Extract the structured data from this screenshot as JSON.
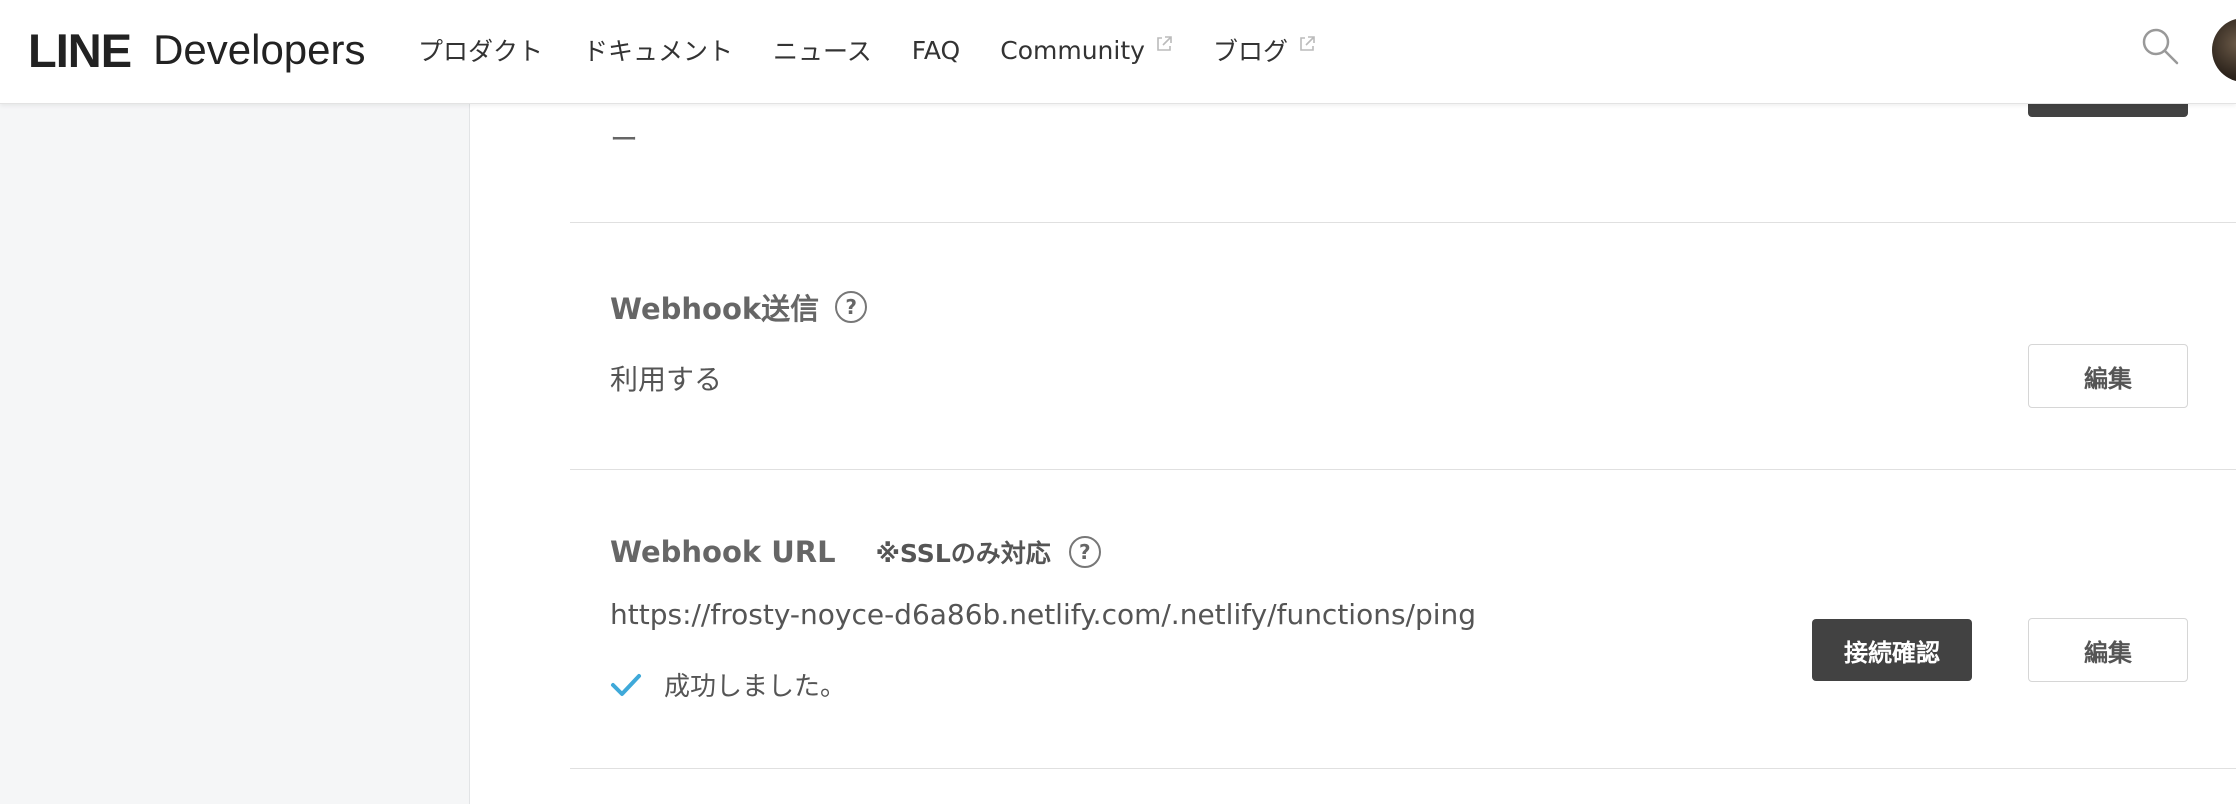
{
  "header": {
    "logo_line": "LINE",
    "logo_developers": "Developers",
    "nav": [
      {
        "label": "プロダクト",
        "external": false
      },
      {
        "label": "ドキュメント",
        "external": false
      },
      {
        "label": "ニュース",
        "external": false
      },
      {
        "label": "FAQ",
        "external": false
      },
      {
        "label": "Community",
        "external": true
      },
      {
        "label": "ブログ",
        "external": true
      }
    ],
    "search_icon": "search-icon",
    "avatar": "user-avatar"
  },
  "top_section": {
    "value": "ー"
  },
  "webhook_send": {
    "title": "Webhook送信",
    "help": "?",
    "value": "利用する",
    "edit_label": "編集"
  },
  "webhook_url": {
    "title": "Webhook URL",
    "ssl_note": "※SSLのみ対応",
    "help": "?",
    "value": "https://frosty-noyce-d6a86b.netlify.com/.netlify/functions/ping",
    "success_text": "成功しました。",
    "verify_label": "接続確認",
    "edit_label": "編集"
  },
  "colors": {
    "check": "#3fa9d9",
    "dark_button": "#424242",
    "sidebar_bg": "#f5f6f7"
  }
}
